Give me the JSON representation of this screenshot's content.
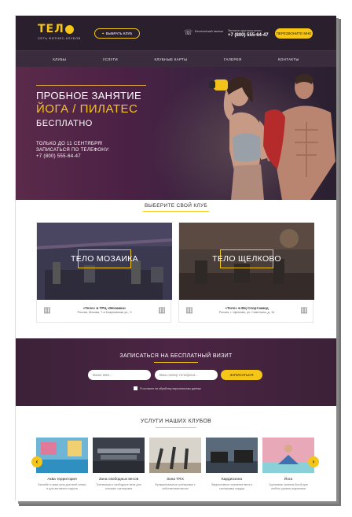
{
  "header": {
    "logo_text": "ТЕЛ",
    "logo_sub": "СЕТЬ ФИТНЕС-КЛУБОВ",
    "club_button": "ВЫБРАТЬ КЛУБ",
    "call_text": "Бесплатный звонок",
    "phone_label": "Звоните круглосуточно",
    "phone": "+7 (800) 555-64-47",
    "callback_button": "ПЕРЕЗВОНИТЕ МНЕ"
  },
  "nav": [
    "КЛУБЫ",
    "УСЛУГИ",
    "КЛУБНЫЕ КАРТЫ",
    "ГАЛЕРЕЯ",
    "КОНТАКТЫ"
  ],
  "hero": {
    "line1": "ПРОБНОЕ ЗАНЯТИЕ",
    "line2": "ЙОГА / ПИЛАТЕС",
    "line3": "БЕСПЛАТНО",
    "info1": "ТОЛЬКО ДО 11 СЕНТЯБРЯ!",
    "info2": "ЗАПИСАТЬСЯ ПО ТЕЛЕФОНУ:",
    "info3": "+7 (800) 555-64-47"
  },
  "clubs": {
    "title": "ВЫБЕРИТЕ СВОЙ КЛУБ",
    "items": [
      {
        "name": "ТЕЛО МОЗАИКА",
        "mall": "«Тело» в ТРЦ «Мозаика»",
        "address": "Россия, Москва, 7-я Кожуховская ул., 9"
      },
      {
        "name": "ТЕЛО ЩЕЛКОВО",
        "mall": "«Тело» в ВЦ Спортзавод",
        "address": "Россия, г. Щелково, ул. Советская, д. 16"
      }
    ]
  },
  "signup": {
    "title": "ЗАПИСАТЬСЯ НА БЕСПЛАТНЫЙ ВИЗИТ",
    "name_placeholder": "Ваше имя...",
    "phone_placeholder": "Ваш номер телефона...",
    "submit": "ЗАПИСАТЬСЯ",
    "agree": "Я согласен на обработку персональных данных"
  },
  "services": {
    "title": "УСЛУГИ НАШИХ КЛУБОВ",
    "items": [
      {
        "name": "Аква территория",
        "desc": "Бассейн и аква-зона для всей семьи и для активного отдыха"
      },
      {
        "name": "Зона свободных весов",
        "desc": "Тренажеры и свободные веса для силовых тренировок"
      },
      {
        "name": "Зона TRX",
        "desc": "Функциональные тренировки с собственным весом"
      },
      {
        "name": "Кардиозона",
        "desc": "Эффективное снижение веса и тренировка сердца"
      },
      {
        "name": "Йога",
        "desc": "Групповые занятия йогой для любого уровня подготовки"
      }
    ]
  },
  "colors": {
    "accent": "#f5c518",
    "dark": "#2a1f2d",
    "purple": "#4c2544"
  }
}
